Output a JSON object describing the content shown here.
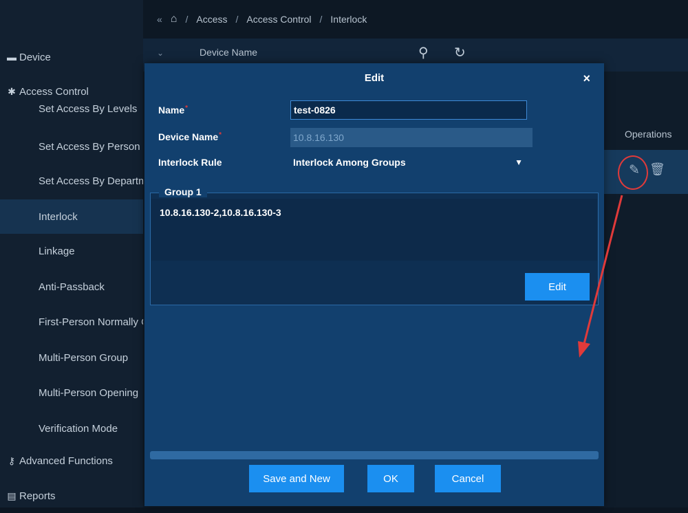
{
  "breadcrumb": {
    "collapse": "«",
    "home_icon": "home-icon",
    "sep1": "/",
    "access": "Access",
    "sep2": "/",
    "access_control": "Access Control",
    "sep3": "/",
    "interlock": "Interlock"
  },
  "searchbar": {
    "label": "Device Name"
  },
  "sidebar": {
    "device": "Device",
    "access_control": "Access Control",
    "items": [
      "Set Access By Levels",
      "Set Access By Person",
      "Set Access By Department",
      "Interlock",
      "Linkage",
      "Anti-Passback",
      "First-Person Normally Open",
      "Multi-Person Group",
      "Multi-Person Opening",
      "Verification Mode"
    ],
    "advanced": "Advanced Functions",
    "reports": "Reports"
  },
  "table": {
    "operations_header": "Operations"
  },
  "modal": {
    "title": "Edit",
    "close": "×",
    "name_label": "Name",
    "name_value": "test-0826",
    "device_label": "Device Name",
    "device_value": "10.8.16.130",
    "rule_label": "Interlock Rule",
    "rule_value": "Interlock Among Groups",
    "group_title": "Group 1",
    "group_members": "10.8.16.130-2,10.8.16.130-3",
    "group_edit": "Edit",
    "save_new": "Save and New",
    "ok": "OK",
    "cancel": "Cancel"
  },
  "colors": {
    "accent": "#1b8ff0",
    "annotation": "#e03a3a"
  }
}
